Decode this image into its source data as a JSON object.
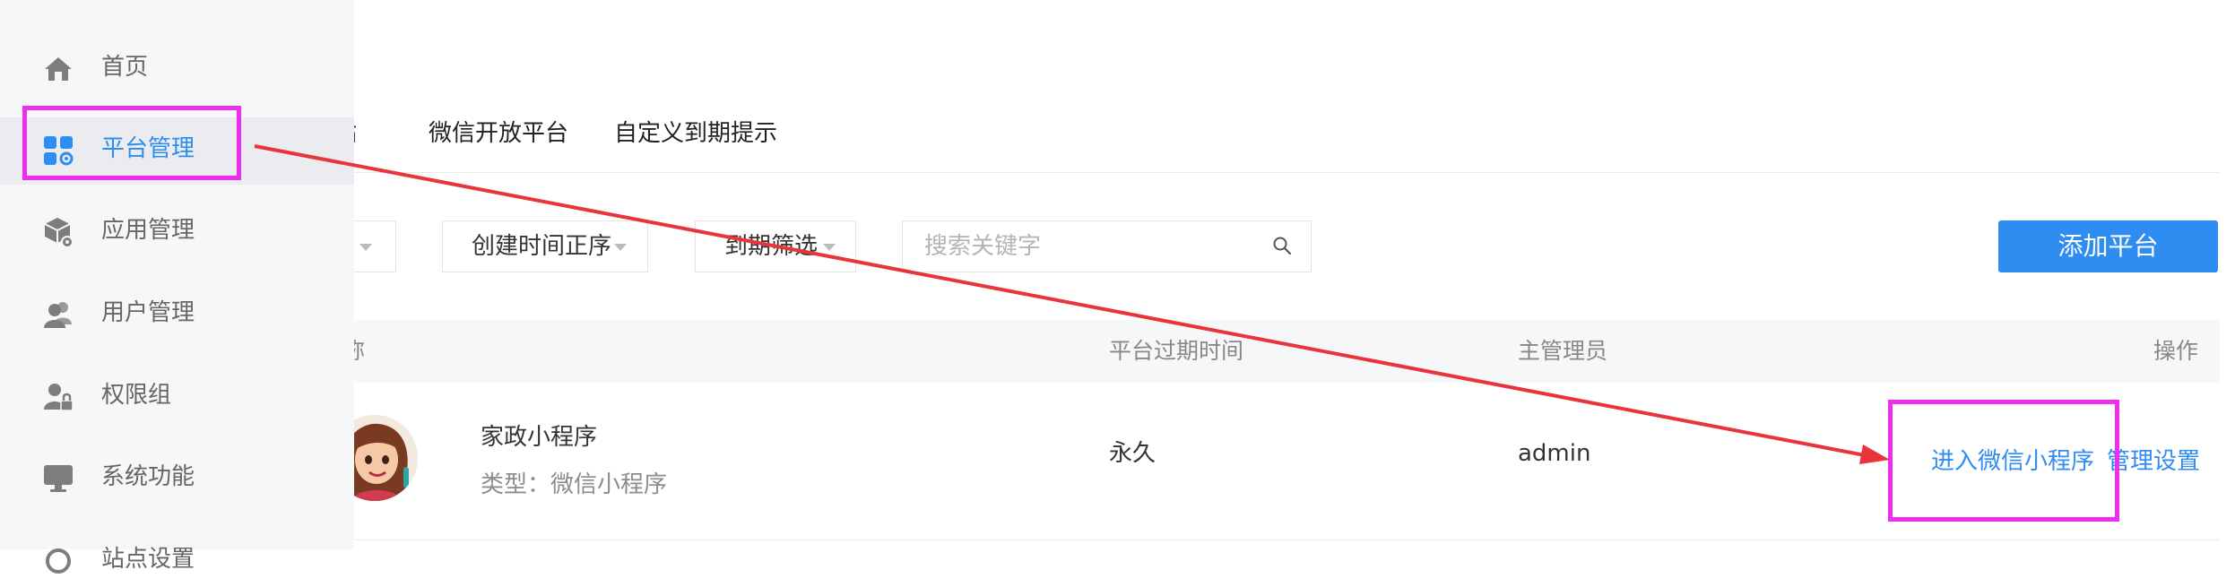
{
  "sidebar": {
    "items": [
      {
        "label": "首页",
        "icon": "home-icon"
      },
      {
        "label": "平台管理",
        "icon": "apps-grid-icon",
        "active": true
      },
      {
        "label": "应用管理",
        "icon": "package-gear-icon"
      },
      {
        "label": "用户管理",
        "icon": "users-icon"
      },
      {
        "label": "权限组",
        "icon": "user-lock-icon"
      },
      {
        "label": "系统功能",
        "icon": "monitor-icon"
      },
      {
        "label": "站点设置",
        "icon": "settings-icon"
      }
    ]
  },
  "tabs": [
    "站",
    "微信开放平台",
    "自定义到期提示"
  ],
  "filters": {
    "sort_label": "创建时间正序",
    "expire_label": "到期筛选",
    "search_placeholder": "搜索关键字",
    "add_button": "添加平台"
  },
  "table": {
    "headers": {
      "name": "称",
      "expire": "平台过期时间",
      "admin": "主管理员",
      "actions": "操作"
    },
    "rows": [
      {
        "name": "家政小程序",
        "type": "类型：微信小程序",
        "expire": "永久",
        "admin": "admin",
        "action_enter": "进入微信小程序",
        "action_manage": "管理设置"
      }
    ]
  },
  "colors": {
    "accent": "#2f8cf0",
    "highlight": "#ee2eee",
    "arrow": "#e8343a",
    "sidebar_bg": "#f6f7f9"
  }
}
